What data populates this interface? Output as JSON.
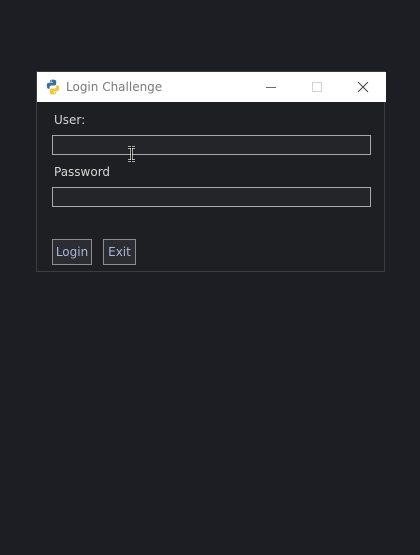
{
  "window": {
    "title": "Login Challenge",
    "icon": "python-icon",
    "controls": [
      "minimize-icon",
      "maximize-icon",
      "close-icon"
    ]
  },
  "form": {
    "user_label": "User:",
    "user_value": "",
    "password_label": "Password",
    "password_value": ""
  },
  "buttons": {
    "login_label": "Login",
    "exit_label": "Exit"
  },
  "colors": {
    "desktop": "#1c1e23",
    "window_bg": "#1e1f22",
    "titlebar": "#ffffff",
    "label_text": "#d6d6d6",
    "button_text": "#a9b7d6",
    "field_border": "#a9a9a9"
  },
  "pointer": "text-cursor-icon"
}
